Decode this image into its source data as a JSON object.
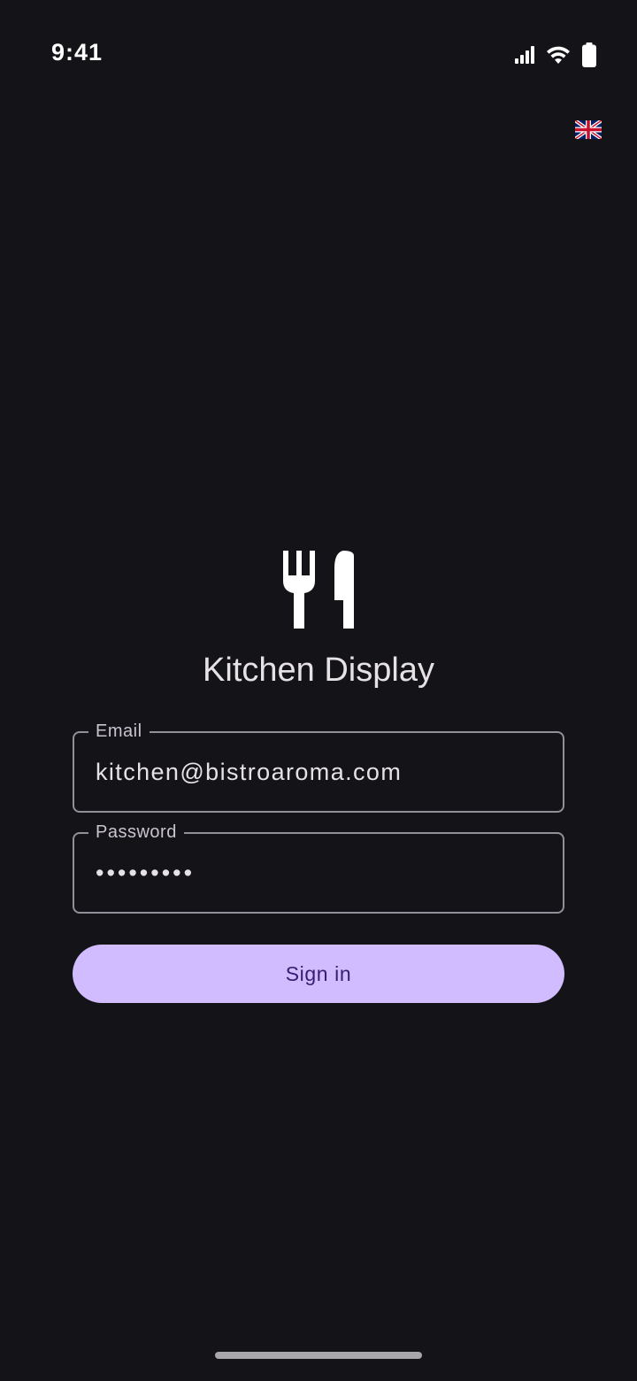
{
  "status_bar": {
    "time": "9:41",
    "icons": [
      "signal-icon",
      "wifi-icon",
      "battery-icon"
    ]
  },
  "language": {
    "icon": "uk-flag-icon"
  },
  "app": {
    "logo_icon": "restaurant-icon",
    "title": "Kitchen Display"
  },
  "form": {
    "email": {
      "label": "Email",
      "value": "kitchen@bistroaroma.com"
    },
    "password": {
      "label": "Password",
      "value": "•••••••••"
    },
    "submit_label": "Sign in"
  },
  "colors": {
    "background": "#141318",
    "outline": "#938f99",
    "primary": "#d0bcff",
    "on_primary": "#381e72",
    "text": "#e6e1e5"
  }
}
